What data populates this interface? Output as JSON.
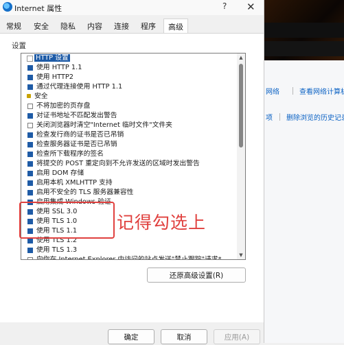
{
  "window": {
    "title": "Internet 属性",
    "help_label": "?",
    "close_label": "✕"
  },
  "tabs": [
    "常规",
    "安全",
    "隐私",
    "内容",
    "连接",
    "程序",
    "高级"
  ],
  "active_tab": "高级",
  "settings_label": "设置",
  "settings_items": [
    {
      "label": "HTTP 设置",
      "kind": "header",
      "icon": "page-icon",
      "selected": true
    },
    {
      "label": "使用 HTTP 1.1",
      "checked": true
    },
    {
      "label": "使用 HTTP2",
      "checked": true
    },
    {
      "label": "通过代理连接使用 HTTP 1.1",
      "checked": true
    },
    {
      "label": "安全",
      "kind": "header",
      "icon": "lock-icon"
    },
    {
      "label": "不将加密的页存盘",
      "checked": false
    },
    {
      "label": "对证书地址不匹配发出警告",
      "checked": true
    },
    {
      "label": "关闭浏览器时清空\"Internet 临时文件\"文件夹",
      "checked": false
    },
    {
      "label": "检查发行商的证书是否已吊销",
      "checked": true
    },
    {
      "label": "检查服务器证书是否已吊销",
      "checked": true
    },
    {
      "label": "检查所下载程序的签名",
      "checked": true
    },
    {
      "label": "将提交的 POST 重定向到不允许发送的区域时发出警告",
      "checked": true
    },
    {
      "label": "启用 DOM 存储",
      "checked": true
    },
    {
      "label": "启用本机 XMLHTTP 支持",
      "checked": true
    },
    {
      "label": "启用不安全的 TLS 服务器兼容性",
      "checked": true
    },
    {
      "label": "启用集成 Windows 验证",
      "checked": true
    },
    {
      "label": "使用 SSL 3.0",
      "checked": true
    },
    {
      "label": "使用 TLS 1.0",
      "checked": true
    },
    {
      "label": "使用 TLS 1.1",
      "checked": true
    },
    {
      "label": "使用 TLS 1.2",
      "checked": true
    },
    {
      "label": "使用 TLS 1.3",
      "checked": true
    },
    {
      "label": "向你在 Internet Explorer 中访问的站点发送\"禁止跟踪\"请求*",
      "checked": false
    }
  ],
  "restore_button": "还原高级设置(R)",
  "annotation": "记得勾选上",
  "footer": {
    "ok": "确定",
    "cancel": "取消",
    "apply": "应用(A)"
  },
  "background": {
    "links_row1": [
      "网络",
      "查看网络计算机"
    ],
    "links_row2": [
      "项",
      "删除浏览的历史记录"
    ]
  },
  "colors": {
    "accent": "#1e5ba6",
    "annotation": "#e0403e",
    "link": "#0b62c4"
  }
}
